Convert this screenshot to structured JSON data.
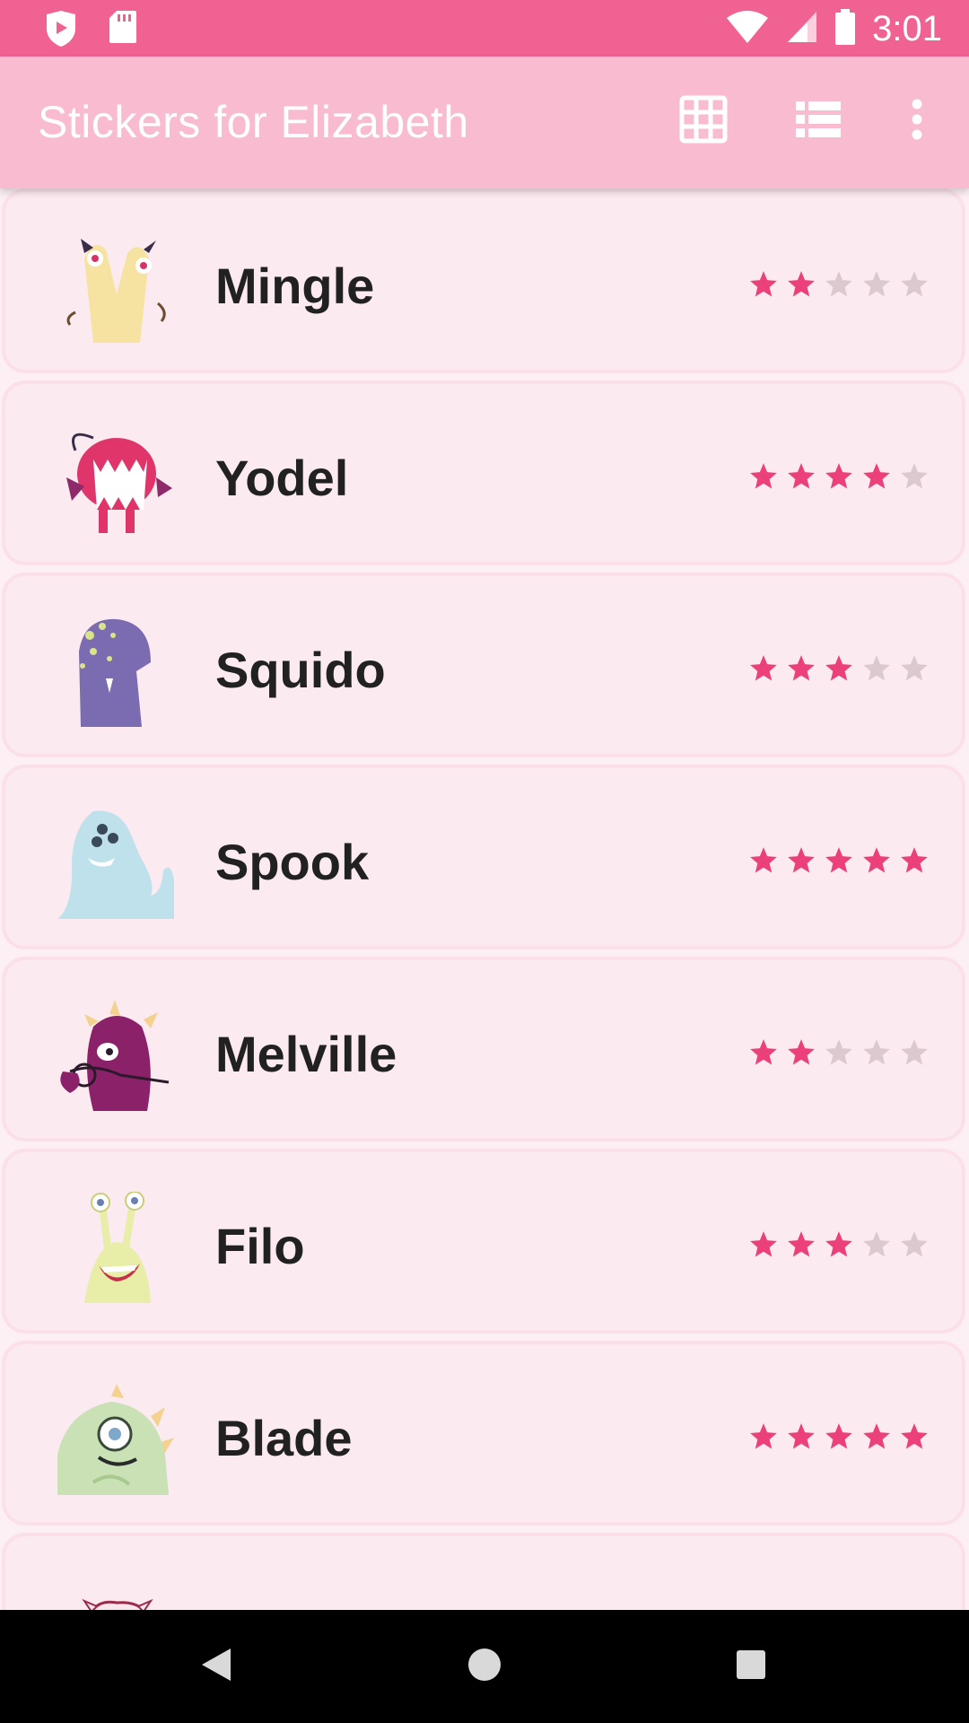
{
  "status_bar": {
    "time": "3:01",
    "left_icons": [
      "play-shield-icon",
      "sd-card-icon"
    ],
    "right_icons": [
      "wifi-icon",
      "cell-signal-icon",
      "battery-icon"
    ]
  },
  "app_bar": {
    "title": "Stickers for Elizabeth",
    "actions": [
      "grid-view-icon",
      "list-view-icon",
      "more-vert-icon"
    ]
  },
  "colors": {
    "status_bar": "#f06292",
    "app_bar": "#f8bbd0",
    "star_filled": "#ec407a",
    "star_empty": "#dcc9cf",
    "card_bg": "#fbeaf0"
  },
  "stickers": [
    {
      "name": "Mingle",
      "rating": 2,
      "icon": "mingle-monster-icon"
    },
    {
      "name": "Yodel",
      "rating": 4,
      "icon": "yodel-monster-icon"
    },
    {
      "name": "Squido",
      "rating": 3,
      "icon": "squido-monster-icon"
    },
    {
      "name": "Spook",
      "rating": 5,
      "icon": "spook-monster-icon"
    },
    {
      "name": "Melville",
      "rating": 2,
      "icon": "melville-monster-icon"
    },
    {
      "name": "Filo",
      "rating": 3,
      "icon": "filo-monster-icon"
    },
    {
      "name": "Blade",
      "rating": 5,
      "icon": "blade-monster-icon"
    },
    {
      "name": "",
      "rating": 0,
      "icon": "partial-monster-icon"
    }
  ],
  "nav_bar": {
    "buttons": [
      "back-icon",
      "home-icon",
      "recents-icon"
    ]
  }
}
